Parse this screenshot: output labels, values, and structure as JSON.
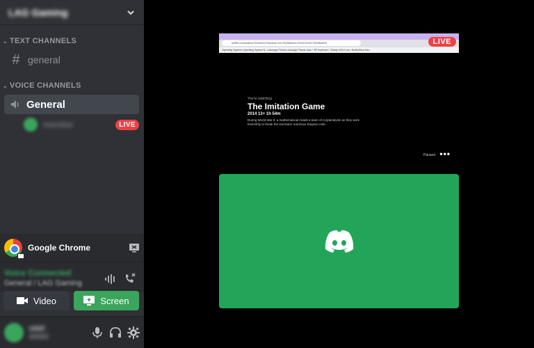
{
  "server": {
    "name": "LAG Gaming"
  },
  "categories": {
    "text": "TEXT CHANNELS",
    "voice": "VOICE CHANNELS"
  },
  "channels": {
    "text": "general",
    "voice": "General"
  },
  "voice_user": {
    "name": "member",
    "live": "LIVE"
  },
  "stream": {
    "app": "Google Chrome"
  },
  "connection": {
    "status": "Voice Connected",
    "sub": "General / LAG Gaming"
  },
  "buttons": {
    "video": "Video",
    "screen": "Screen"
  },
  "user": {
    "name": "user",
    "tag": "#0000"
  },
  "preview": {
    "url": "netflix.com/watch/70281613?trackId=14170286&tctx=0%2C0%2C7fe5f0a3b9",
    "bookmarks": "Operating Systems   Operating System N..   Lobsang's Thesis   Lobsang's Thesis   Java + SP Implemen..   Bharty UX/UI Lea..   BoxMoTech-Eaz..",
    "live": "LIVE",
    "watching": "You're watching",
    "title": "The Imitation Game",
    "meta": "2014   13+   1h 54m",
    "description": "During World War II, a mathematician leads a team of cryptanalysts as they work feverishly to break the Germans' notorious Enigma code.",
    "paused": "Paused",
    "dots": "•••"
  },
  "icons": {
    "chevron": "chevron-down-icon",
    "hash": "hash-icon",
    "speaker": "speaker-icon",
    "chrome": "chrome-icon",
    "stop": "stop-stream-icon",
    "wave": "soundwave-icon",
    "hangup": "disconnect-icon",
    "video": "video-camera-icon",
    "screen": "screen-share-icon",
    "mic": "microphone-icon",
    "headset": "headphones-icon",
    "settings": "gear-icon",
    "discord": "discord-logo-icon"
  },
  "colors": {
    "green": "#23a559",
    "live_red": "#ed4245",
    "sidebar": "#2f3136"
  }
}
